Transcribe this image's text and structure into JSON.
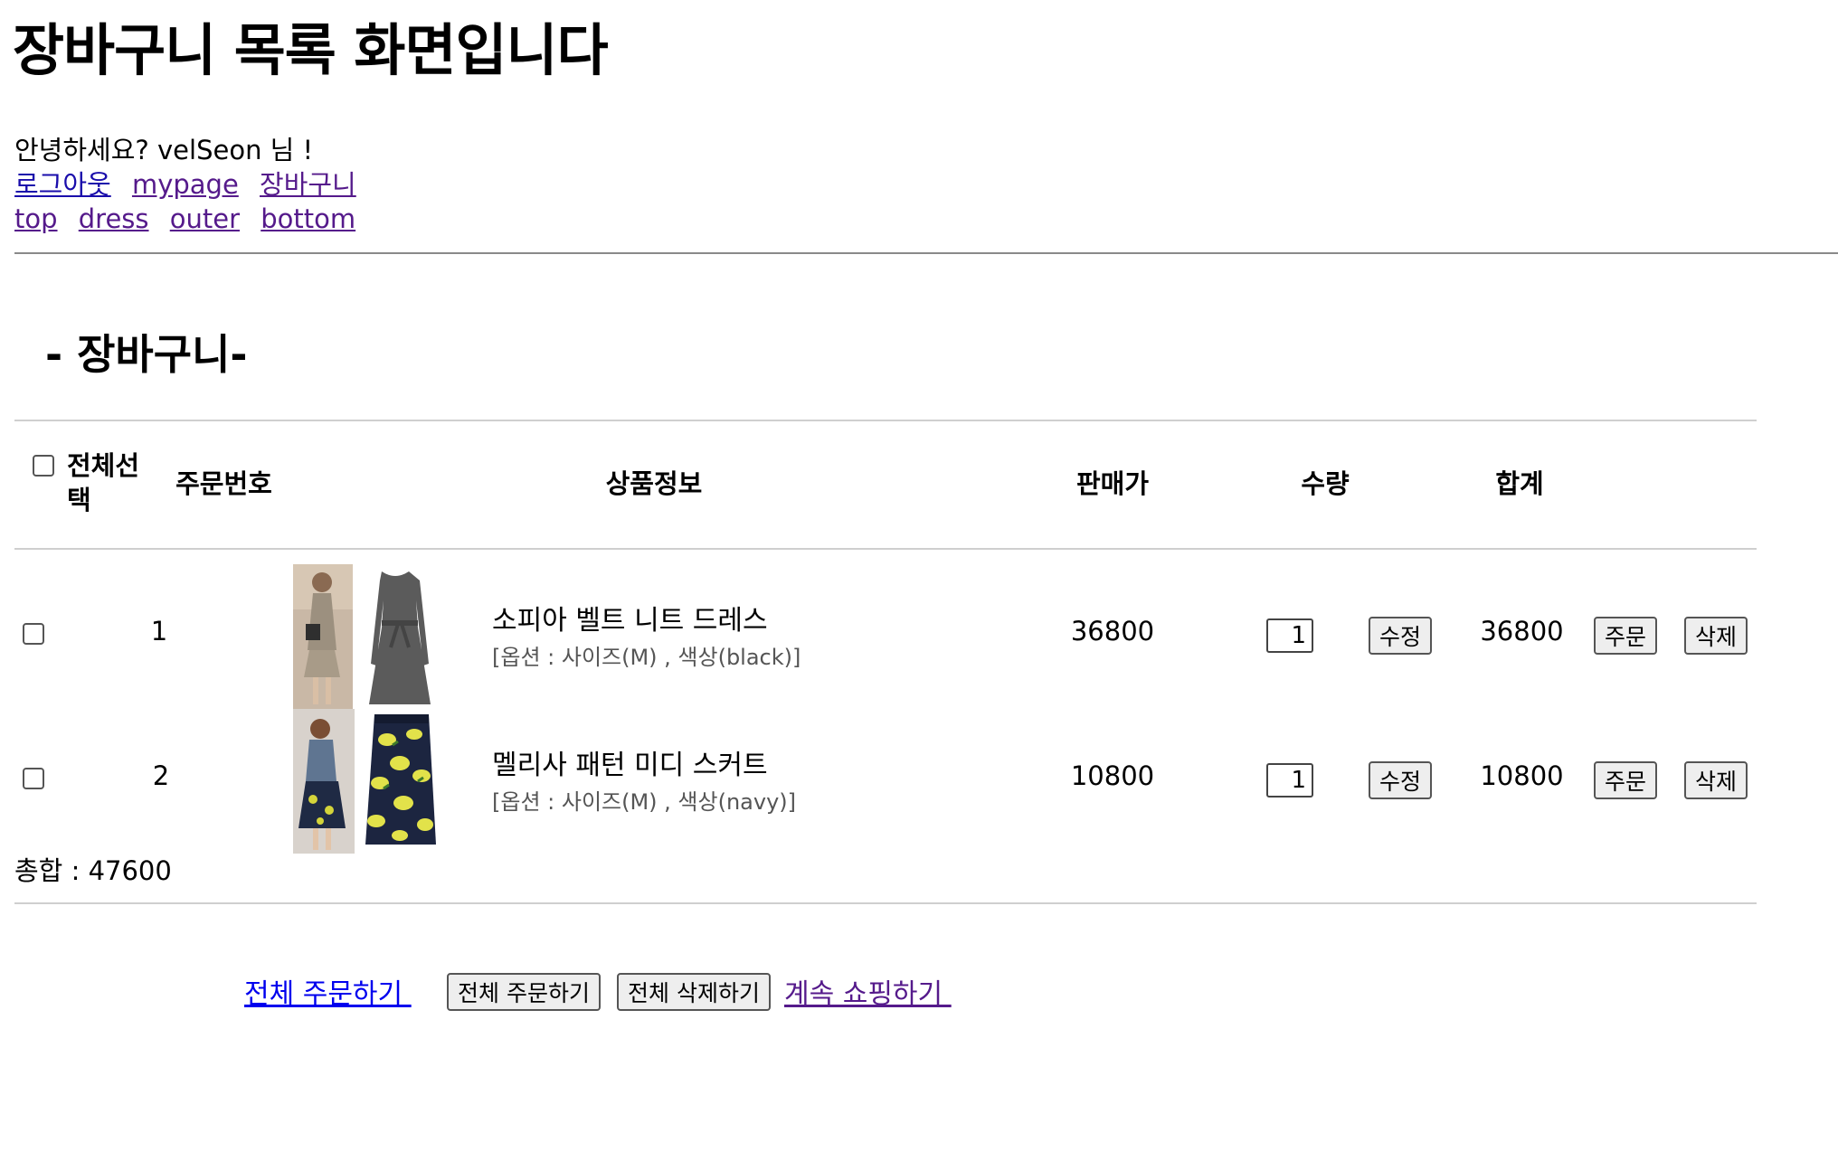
{
  "header": {
    "title": "장바구니 목록 화면입니다",
    "greeting": "안녕하세요? velSeon 님 !",
    "account_links": [
      "로그아웃",
      "mypage",
      "장바구니"
    ],
    "category_links": [
      "top",
      "dress",
      "outer",
      "bottom"
    ]
  },
  "cart": {
    "section_title": "- 장바구니-",
    "columns": {
      "select_all": "전체선택",
      "order_no": "주문번호",
      "product_info": "상품정보",
      "price": "판매가",
      "quantity": "수량",
      "total": "합계"
    },
    "rows": [
      {
        "order_no": "1",
        "name": "소피아 벨트 니트 드레스",
        "option": "[옵션 : 사이즈(M) , 색상(black)]",
        "price": "36800",
        "quantity": "1",
        "subtotal": "36800",
        "edit_label": "수정",
        "order_label": "주문",
        "delete_label": "삭제"
      },
      {
        "order_no": "2",
        "name": "멜리사 패턴 미디 스커트",
        "option": "[옵션 : 사이즈(M) , 색상(navy)]",
        "price": "10800",
        "quantity": "1",
        "subtotal": "10800",
        "edit_label": "수정",
        "order_label": "주문",
        "delete_label": "삭제"
      }
    ],
    "grand_total": "총합 : 47600"
  },
  "actions": {
    "order_all_link": "전체 주문하기 ",
    "order_all_button": "전체 주문하기",
    "delete_all_button": "전체 삭제하기",
    "continue_link": "계속 쇼핑하기 "
  },
  "colors": {
    "link": "#1a0dab",
    "visited_link": "#551a8b",
    "divider": "#cfcfcf"
  }
}
